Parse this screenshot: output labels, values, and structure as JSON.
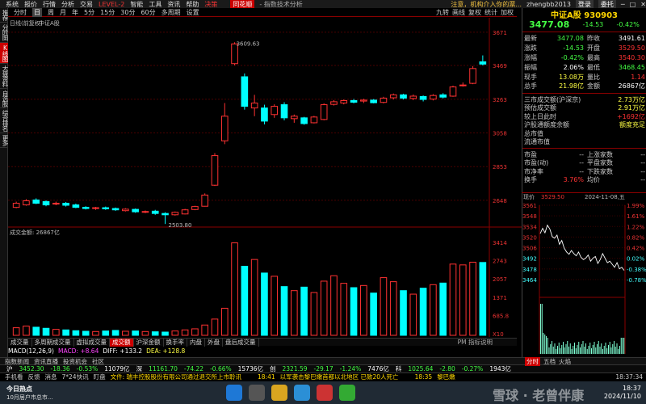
{
  "menu": {
    "items": [
      "系统",
      "报价",
      "行情",
      "分析",
      "交易"
    ],
    "level2": "LEVEL-2",
    "items2": [
      "智能",
      "工具",
      "资讯",
      "帮助",
      "决策"
    ],
    "logo": "同花顺",
    "title": "- 指数技术分析",
    "news": "注意，机构介入你的票...",
    "user": "zhengbb2013",
    "login": "登录",
    "vip": "委托"
  },
  "left_strip": [
    {
      "label": "推荐",
      "on": false
    },
    {
      "label": "分时图",
      "on": false
    },
    {
      "label": "K线图",
      "on": true
    },
    {
      "label": "大盘资料",
      "on": false
    },
    {
      "label": "自选股",
      "on": false
    },
    {
      "label": "综合排名",
      "on": false
    },
    {
      "label": "更多",
      "on": false
    }
  ],
  "periods": {
    "items": [
      "分时",
      "日",
      "周",
      "月",
      "年",
      "5分",
      "15分",
      "30分",
      "60分",
      "多周期",
      "设置"
    ],
    "active": "日",
    "tools": [
      "九转",
      "画线",
      "复权",
      "统计",
      "加权"
    ]
  },
  "chart": {
    "label_adjust": "日线(前复权)",
    "index_name": "中证A股",
    "high_label": "3609.63",
    "low_label": "2503.80",
    "volume_label": "成交金额: 26867亿",
    "price_axis": [
      "3671",
      "3469",
      "3263",
      "3058",
      "2853",
      "2648"
    ],
    "vol_axis": [
      "3414",
      "2743",
      "2057",
      "1371",
      "685.8",
      "X10"
    ]
  },
  "chart_data": {
    "type": "candlestick+bar",
    "candles": [
      {
        "o": 2605,
        "c": 2630,
        "h": 2640,
        "l": 2600,
        "up": true
      },
      {
        "o": 2620,
        "c": 2645,
        "h": 2655,
        "l": 2615,
        "up": true
      },
      {
        "o": 2650,
        "c": 2630,
        "h": 2660,
        "l": 2625,
        "up": false
      },
      {
        "o": 2640,
        "c": 2620,
        "h": 2648,
        "l": 2612,
        "up": false
      },
      {
        "o": 2625,
        "c": 2630,
        "h": 2640,
        "l": 2618,
        "up": true
      },
      {
        "o": 2630,
        "c": 2618,
        "h": 2638,
        "l": 2610,
        "up": false
      },
      {
        "o": 2620,
        "c": 2605,
        "h": 2628,
        "l": 2600,
        "up": false
      },
      {
        "o": 2605,
        "c": 2598,
        "h": 2612,
        "l": 2592,
        "up": false
      },
      {
        "o": 2598,
        "c": 2603,
        "h": 2608,
        "l": 2590,
        "up": true
      },
      {
        "o": 2603,
        "c": 2596,
        "h": 2610,
        "l": 2590,
        "up": false
      },
      {
        "o": 2598,
        "c": 2590,
        "h": 2604,
        "l": 2584,
        "up": false
      },
      {
        "o": 2585,
        "c": 2594,
        "h": 2600,
        "l": 2580,
        "up": true
      },
      {
        "o": 2593,
        "c": 2578,
        "h": 2598,
        "l": 2572,
        "up": false
      },
      {
        "o": 2578,
        "c": 2580,
        "h": 2586,
        "l": 2570,
        "up": true
      },
      {
        "o": 2582,
        "c": 2568,
        "h": 2590,
        "l": 2560,
        "up": false
      },
      {
        "o": 2568,
        "c": 2560,
        "h": 2575,
        "l": 2504,
        "up": false
      },
      {
        "o": 2560,
        "c": 2575,
        "h": 2580,
        "l": 2555,
        "up": true
      },
      {
        "o": 2565,
        "c": 2590,
        "h": 2596,
        "l": 2562,
        "up": true
      },
      {
        "o": 2592,
        "c": 2610,
        "h": 2615,
        "l": 2588,
        "up": true
      },
      {
        "o": 2612,
        "c": 2680,
        "h": 2690,
        "l": 2610,
        "up": true
      },
      {
        "o": 2740,
        "c": 2920,
        "h": 2935,
        "l": 2735,
        "up": true
      },
      {
        "o": 3010,
        "c": 3160,
        "h": 3240,
        "l": 2990,
        "up": true
      },
      {
        "o": 3480,
        "c": 3600,
        "h": 3610,
        "l": 3470,
        "up": true
      },
      {
        "o": 3400,
        "c": 3220,
        "h": 3420,
        "l": 3200,
        "up": false
      },
      {
        "o": 3210,
        "c": 3240,
        "h": 3290,
        "l": 3160,
        "up": true
      },
      {
        "o": 3210,
        "c": 3130,
        "h": 3230,
        "l": 3110,
        "up": false
      },
      {
        "o": 3170,
        "c": 3220,
        "h": 3232,
        "l": 3150,
        "up": true
      },
      {
        "o": 3230,
        "c": 3150,
        "h": 3245,
        "l": 3135,
        "up": false
      },
      {
        "o": 3145,
        "c": 3160,
        "h": 3170,
        "l": 3120,
        "up": true
      },
      {
        "o": 3150,
        "c": 3115,
        "h": 3156,
        "l": 3108,
        "up": false
      },
      {
        "o": 3120,
        "c": 3155,
        "h": 3162,
        "l": 3116,
        "up": true
      },
      {
        "o": 3140,
        "c": 3230,
        "h": 3238,
        "l": 3135,
        "up": true
      },
      {
        "o": 3232,
        "c": 3248,
        "h": 3258,
        "l": 3225,
        "up": true
      },
      {
        "o": 3240,
        "c": 3255,
        "h": 3262,
        "l": 3232,
        "up": true
      },
      {
        "o": 3255,
        "c": 3245,
        "h": 3265,
        "l": 3238,
        "up": false
      },
      {
        "o": 3252,
        "c": 3258,
        "h": 3266,
        "l": 3240,
        "up": true
      },
      {
        "o": 3258,
        "c": 3242,
        "h": 3264,
        "l": 3238,
        "up": false
      },
      {
        "o": 3244,
        "c": 3270,
        "h": 3278,
        "l": 3238,
        "up": true
      },
      {
        "o": 3272,
        "c": 3290,
        "h": 3298,
        "l": 3262,
        "up": true
      },
      {
        "o": 3290,
        "c": 3270,
        "h": 3296,
        "l": 3262,
        "up": false
      },
      {
        "o": 3268,
        "c": 3282,
        "h": 3292,
        "l": 3258,
        "up": true
      },
      {
        "o": 3280,
        "c": 3262,
        "h": 3286,
        "l": 3250,
        "up": false
      },
      {
        "o": 3264,
        "c": 3286,
        "h": 3294,
        "l": 3256,
        "up": true
      },
      {
        "o": 3290,
        "c": 3276,
        "h": 3300,
        "l": 3268,
        "up": false
      },
      {
        "o": 3282,
        "c": 3338,
        "h": 3346,
        "l": 3278,
        "up": true
      },
      {
        "o": 3345,
        "c": 3350,
        "h": 3365,
        "l": 3340,
        "up": true
      },
      {
        "o": 3360,
        "c": 3450,
        "h": 3465,
        "l": 3355,
        "up": true
      },
      {
        "o": 3491,
        "c": 3477,
        "h": 3530,
        "l": 3469,
        "up": false
      }
    ],
    "volume": [
      2.8,
      3.4,
      3.0,
      2.6,
      2.2,
      2.0,
      1.7,
      1.5,
      1.4,
      1.6,
      1.8,
      1.5,
      1.6,
      1.4,
      1.3,
      1.2,
      1.6,
      2.0,
      2.4,
      3.8,
      6.0,
      10.0,
      34.14,
      25.5,
      28.0,
      23.0,
      21.8,
      18.0,
      16.5,
      17.8,
      15.8,
      20.0,
      22.0,
      19.2,
      17.6,
      18.4,
      15.6,
      21.3,
      19.8,
      16.5,
      15.2,
      17.4,
      18.7,
      19.3,
      26.3,
      26.0,
      27.0,
      26.9
    ],
    "ylim": [
      2500,
      3700
    ]
  },
  "bottom_tabs": {
    "items": [
      "成交量",
      "多周期成交量",
      "虚拟成交量",
      "成交额",
      "沪深金额",
      "换手率",
      "内盘",
      "外盘",
      "盘后成交量"
    ],
    "active": "成交额",
    "params": "PM",
    "explain": "指标说明"
  },
  "macd": {
    "label": "MACD(12,26,9)",
    "macd_v": "MACD: +8.64",
    "diff_v": "DIFF: +133.2",
    "dea_v": "DEA: +128.8"
  },
  "index_tabs": [
    "指数新闻",
    "资讯直播",
    "投资机会",
    "社区"
  ],
  "ticker": [
    {
      "text": "沪",
      "cls": "white"
    },
    {
      "text": "3452.30",
      "cls": "green"
    },
    {
      "text": "-18.36",
      "cls": "green"
    },
    {
      "text": "-0.53%",
      "cls": "green"
    },
    {
      "text": "11079亿",
      "cls": "white"
    },
    {
      "text": "深",
      "cls": "white"
    },
    {
      "text": "11161.70",
      "cls": "green"
    },
    {
      "text": "-74.22",
      "cls": "green"
    },
    {
      "text": "-0.66%",
      "cls": "green"
    },
    {
      "text": "15736亿",
      "cls": "white"
    },
    {
      "text": "创",
      "cls": "white"
    },
    {
      "text": "2321.59",
      "cls": "green"
    },
    {
      "text": "-29.17",
      "cls": "green"
    },
    {
      "text": "-1.24%",
      "cls": "green"
    },
    {
      "text": "7476亿",
      "cls": "white"
    },
    {
      "text": "科",
      "cls": "white"
    },
    {
      "text": "1025.64",
      "cls": "green"
    },
    {
      "text": "-2.80",
      "cls": "green"
    },
    {
      "text": "-0.27%",
      "cls": "green"
    },
    {
      "text": "1943亿",
      "cls": "white"
    }
  ],
  "newsbar": {
    "items": [
      "手机看",
      "反馈",
      "消息",
      "7*24快讯",
      "盯盘"
    ],
    "news1": "文件: 瑞丰控股股份有限公司通过退交所上市聆讯",
    "time2": "18:41",
    "news2": "以军袭击黎巴嫩首都以北地区 已致20人死亡",
    "time3": "18:35",
    "news3": "黎巴嫩",
    "clock": "18:37:34"
  },
  "taskbar": {
    "widget_title": "今日热点",
    "widget_sub": "10月居户市总市...",
    "time": "18:37",
    "date": "2024/11/10",
    "watermark": "雪球 · 老曾伴康"
  },
  "panel": {
    "title": "中证A股  930903",
    "price": "3477.08",
    "change": "-14.53",
    "pct": "-0.42%",
    "rows": [
      {
        "k": "最新",
        "v": "3477.08",
        "vc": "green",
        "k2": "昨收",
        "v2": "3491.61",
        "v2c": "white"
      },
      {
        "k": "涨跌",
        "v": "-14.53",
        "vc": "green",
        "k2": "开盘",
        "v2": "3529.50",
        "v2c": "red"
      },
      {
        "k": "涨幅",
        "v": "-0.42%",
        "vc": "green",
        "k2": "最高",
        "v2": "3540.30",
        "v2c": "red"
      },
      {
        "k": "振幅",
        "v": "2.06%",
        "vc": "white",
        "k2": "最低",
        "v2": "3468.45",
        "v2c": "green"
      },
      {
        "k": "现手",
        "v": "13.08万",
        "vc": "yellow",
        "k2": "量比",
        "v2": "1.14",
        "v2c": "red"
      },
      {
        "k": "总手",
        "v": "21.98亿",
        "vc": "yellow",
        "k2": "金额",
        "v2": "26867亿",
        "v2c": "white"
      }
    ],
    "extra": [
      {
        "k": "三市成交额(沪深京)",
        "v": "2.73万亿"
      },
      {
        "k": "预估成交额",
        "v": "2.91万亿"
      },
      {
        "k": "较上日此时",
        "v": "+1692亿"
      },
      {
        "k": "沪股通额度余额",
        "v": "额度充足"
      },
      {
        "k": "总市值",
        "v": ""
      },
      {
        "k": "流通市值",
        "v": ""
      }
    ],
    "stats": [
      {
        "k": "市盈",
        "v": "--",
        "k2": "上涨家数",
        "v2": "--"
      },
      {
        "k": "市盈(动)",
        "v": "--",
        "k2": "平盘家数",
        "v2": "--"
      },
      {
        "k": "市净率",
        "v": "--",
        "k2": "下跌家数",
        "v2": "--"
      },
      {
        "k": "换手",
        "v": "3.76%",
        "k2": "均价",
        "v2": "--"
      }
    ],
    "mini": {
      "label_now": "现价",
      "label_price": "3529.50",
      "label_date": "2024-11-08,五",
      "left_axis": [
        "3561",
        "3548",
        "3534",
        "3520",
        "3506",
        "3492",
        "3478",
        "3464"
      ],
      "right_axis": [
        "1.99%",
        "1.61%",
        "1.22%",
        "0.82%",
        "0.42%",
        "0.02%",
        "-0.38%",
        "-0.78%"
      ]
    },
    "tabs": [
      "分时",
      "五档",
      "火焰"
    ],
    "tab_active": "分时"
  }
}
